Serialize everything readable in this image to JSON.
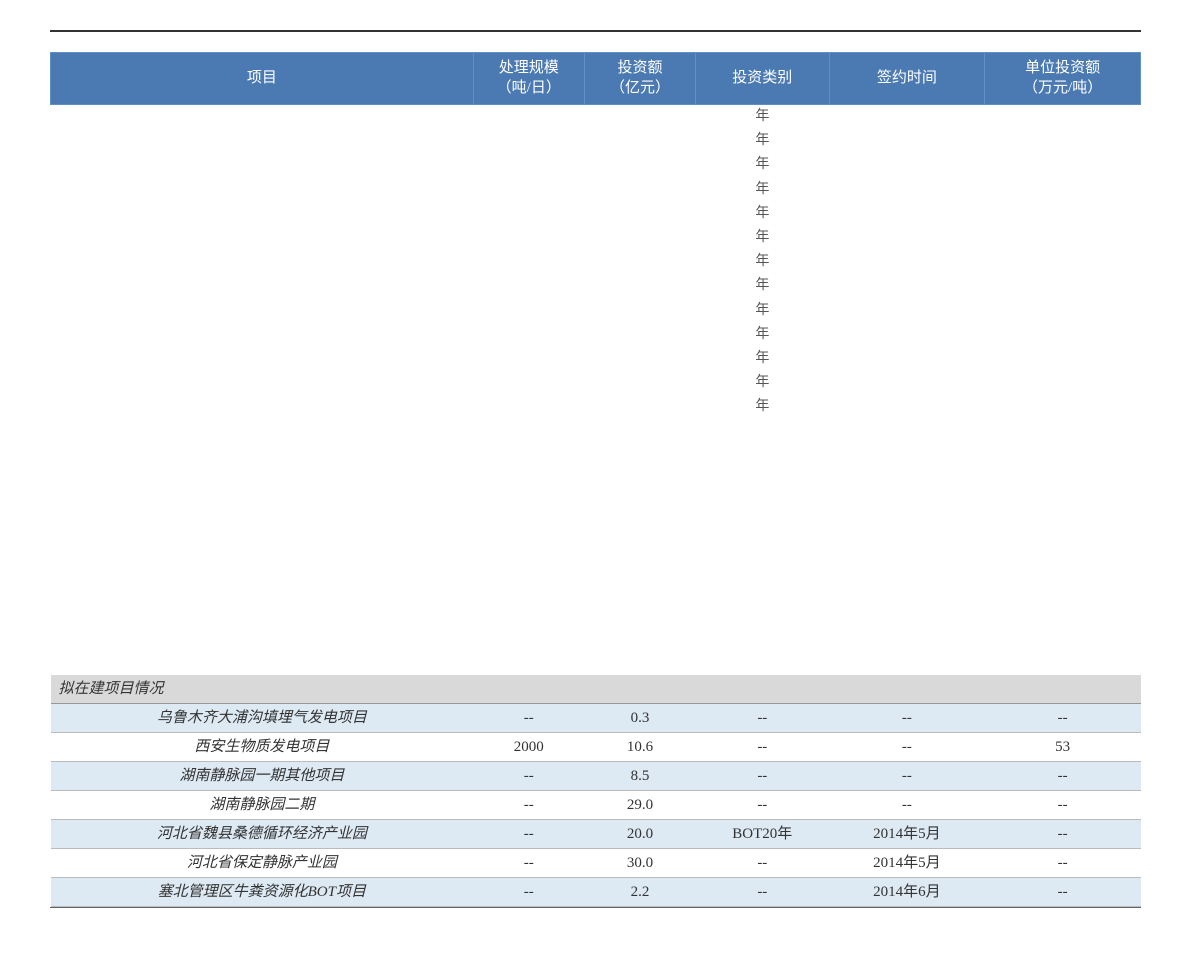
{
  "header": {
    "project": "项目",
    "scale": "处理规模\n（吨/日）",
    "invest": "投资额\n（亿元）",
    "type": "投资类别",
    "time": "签约时间",
    "unit": "单位投资额\n（万元/吨）"
  },
  "year_marker": "年",
  "section1": {
    "title": "拟在建项目情况"
  },
  "rows": [
    {
      "project": "乌鲁木齐大浦沟填埋气发电项目",
      "scale": "--",
      "invest": "0.3",
      "type": "--",
      "time": "--",
      "unit": "--",
      "stripe": true
    },
    {
      "project": "西安生物质发电项目",
      "scale": "2000",
      "invest": "10.6",
      "type": "--",
      "time": "--",
      "unit": "53",
      "stripe": false
    },
    {
      "project": "湖南静脉园一期其他项目",
      "scale": "--",
      "invest": "8.5",
      "type": "--",
      "time": "--",
      "unit": "--",
      "stripe": true
    },
    {
      "project": "湖南静脉园二期",
      "scale": "--",
      "invest": "29.0",
      "type": "--",
      "time": "--",
      "unit": "--",
      "stripe": false
    },
    {
      "project": "河北省魏县桑德循环经济产业园",
      "scale": "--",
      "invest": "20.0",
      "type": "BOT20年",
      "time": "2014年5月",
      "unit": "--",
      "stripe": true
    },
    {
      "project": "河北省保定静脉产业园",
      "scale": "--",
      "invest": "30.0",
      "type": "--",
      "time": "2014年5月",
      "unit": "--",
      "stripe": false
    },
    {
      "project": "塞北管理区牛粪资源化BOT项目",
      "scale": "--",
      "invest": "2.2",
      "type": "--",
      "time": "2014年6月",
      "unit": "--",
      "stripe": true
    }
  ],
  "chart_data": {
    "type": "table",
    "title": "拟在建项目情况",
    "columns": [
      "项目",
      "处理规模（吨/日）",
      "投资额（亿元）",
      "投资类别",
      "签约时间",
      "单位投资额（万元/吨）"
    ],
    "data": [
      [
        "乌鲁木齐大浦沟填埋气发电项目",
        null,
        0.3,
        null,
        null,
        null
      ],
      [
        "西安生物质发电项目",
        2000,
        10.6,
        null,
        null,
        53
      ],
      [
        "湖南静脉园一期其他项目",
        null,
        8.5,
        null,
        null,
        null
      ],
      [
        "湖南静脉园二期",
        null,
        29.0,
        null,
        null,
        null
      ],
      [
        "河北省魏县桑德循环经济产业园",
        null,
        20.0,
        "BOT20年",
        "2014年5月",
        null
      ],
      [
        "河北省保定静脉产业园",
        null,
        30.0,
        null,
        "2014年5月",
        null
      ],
      [
        "塞北管理区牛粪资源化BOT项目",
        null,
        2.2,
        null,
        "2014年6月",
        null
      ]
    ]
  }
}
